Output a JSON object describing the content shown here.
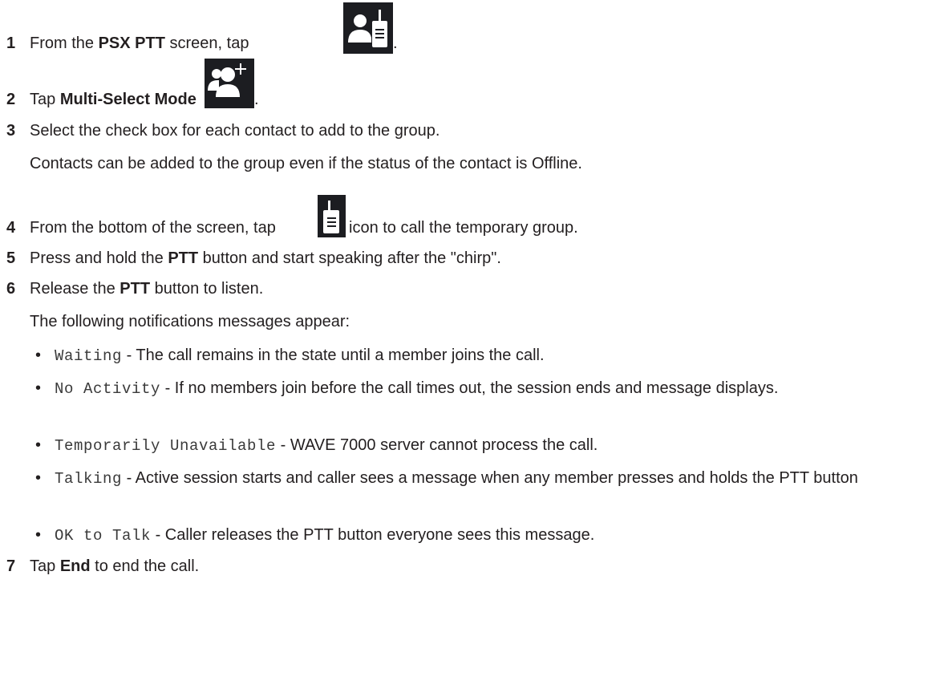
{
  "steps": [
    {
      "num": "1",
      "pre": "From the ",
      "bold": "PSX PTT",
      "post": " screen, tap",
      "tail": "."
    },
    {
      "num": "2",
      "pre": "Tap ",
      "bold": "Multi-Select Mode",
      "tail": "."
    },
    {
      "num": "3",
      "text": "Select the check box for each contact to add to the group."
    },
    {
      "num": "4",
      "pre": "From the bottom of the screen, tap",
      "post": "icon to call the temporary group."
    },
    {
      "num": "5",
      "pre": "Press and hold the ",
      "bold": "PTT",
      "post": " button and start speaking after the \"chirp\"."
    },
    {
      "num": "6",
      "pre": "Release the ",
      "bold": "PTT",
      "post": " button to listen."
    },
    {
      "num": "7",
      "pre": "Tap ",
      "bold": "End",
      "post": " to end the call."
    }
  ],
  "step3_note": "Contacts can be added to the group even if the status of the contact is Offline.",
  "step6_note": "The following notifications messages appear:",
  "notifications": [
    {
      "code": "Waiting",
      "desc": " - The call remains in the state until a member joins the call."
    },
    {
      "code": "No Activity",
      "desc": " - If no members join before the call times out, the session ends and message displays."
    },
    {
      "code": "Temporarily Unavailable",
      "desc": " - WAVE 7000 server cannot process the call."
    },
    {
      "code": "Talking",
      "desc": " - Active session starts and caller sees a message when any member presses and holds the PTT button"
    },
    {
      "code": "OK to Talk",
      "desc": " - Caller releases the PTT button everyone sees this message."
    }
  ],
  "bullet_char": "•",
  "icons": {
    "step1": "contact-radio-icon",
    "step2": "add-contact-icon",
    "step4": "radio-call-icon"
  }
}
